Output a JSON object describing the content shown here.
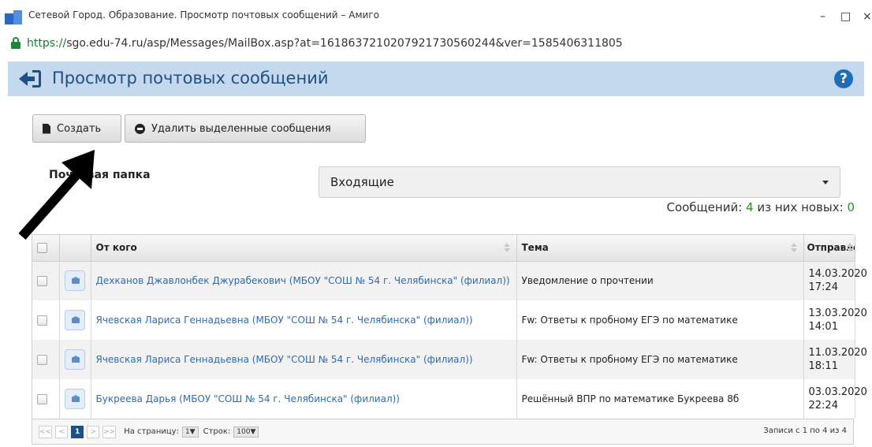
{
  "window": {
    "title": "Сетевой Город. Образование. Просмотр почтовых сообщений – Амиго",
    "minimize_label": "–",
    "maximize_label": "□",
    "close_label": "×"
  },
  "address": {
    "scheme": "https://",
    "rest": "sgo.edu-74.ru/asp/Messages/MailBox.asp?at=161863721020792173056024​4&ver=1585406311805"
  },
  "header": {
    "title": "Просмотр почтовых сообщений",
    "help_label": "?"
  },
  "toolbar": {
    "create_label": "Создать",
    "delete_label": "Удалить выделенные сообщения"
  },
  "folder": {
    "label": "Почтовая папка",
    "selected": "Входящие"
  },
  "counts": {
    "messages_label": "Сообщений:",
    "messages": "4",
    "new_label": "из них новых:",
    "new": "0"
  },
  "table": {
    "columns": [
      "От кого",
      "Тема",
      "Отправлено"
    ],
    "rows": [
      {
        "sender": "Дехканов Джавлонбек Джурабекович (МБОУ \"СОШ № 54 г. Челябинска\" (филиал))",
        "subject": "Уведомление о прочтении",
        "date": "14.03.2020",
        "time": "17:24"
      },
      {
        "sender": "Ячевская Лариса Геннадьевна (МБОУ \"СОШ № 54 г. Челябинска\" (филиал))",
        "subject": "Fw: Ответы к пробному ЕГЭ по математике",
        "date": "13.03.2020",
        "time": "14:01"
      },
      {
        "sender": "Ячевская Лариса Геннадьевна (МБОУ \"СОШ № 54 г. Челябинска\" (филиал))",
        "subject": "Fw: Ответы к пробному ЕГЭ по математике",
        "date": "11.03.2020",
        "time": "18:11"
      },
      {
        "sender": "Букреева Дарья (МБОУ \"СОШ № 54 г. Челябинска\" (филиал))",
        "subject": "Решённый ВПР по математике Букреева 8б",
        "date": "03.03.2020",
        "time": "22:24"
      }
    ]
  },
  "pager": {
    "first": "<<",
    "prev": "<",
    "current": "1",
    "next": ">",
    "last": ">>",
    "per_page_label": "На страницу:",
    "per_page_value": "1▼",
    "rows_label": "Строк:",
    "rows_value": "100▼",
    "records": "Записи с 1 по 4 из 4"
  }
}
